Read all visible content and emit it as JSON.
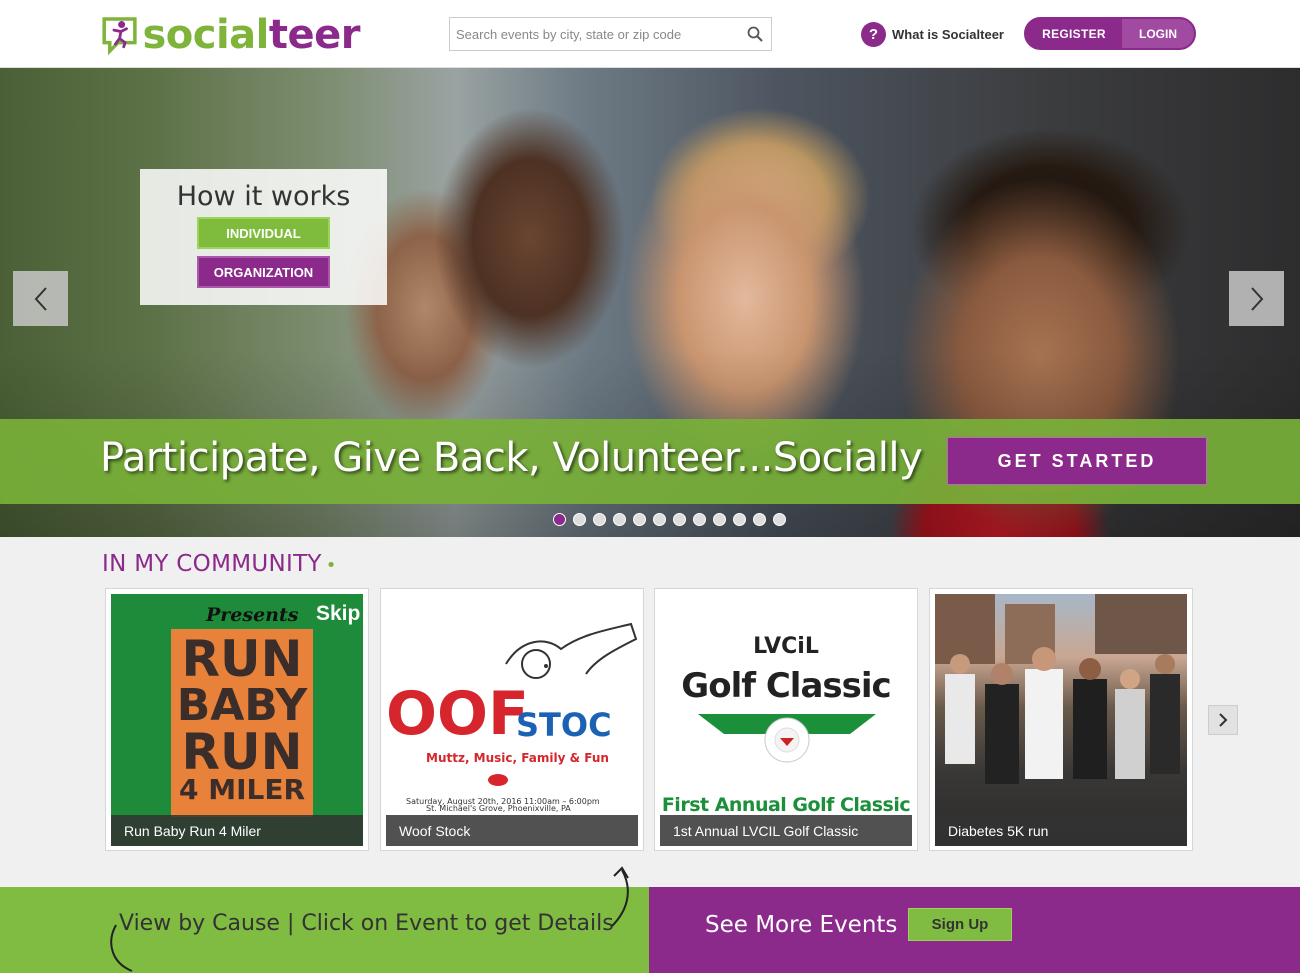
{
  "header": {
    "logo_text_a": "social",
    "logo_text_b": "teer",
    "search_placeholder": "Search events by city, state or zip code",
    "what_is_label": "What is Socialteer",
    "help_glyph": "?",
    "register_label": "REGISTER",
    "login_label": "LOGIN"
  },
  "hero": {
    "how_title": "How it works",
    "individual_label": "INDIVIDUAL",
    "organization_label": "ORGANIZATION",
    "tagline": "Participate, Give Back, Volunteer...Socially",
    "cta_label": "GET STARTED",
    "slide_count": 12,
    "active_slide": 1
  },
  "community": {
    "title": "IN MY COMMUNITY",
    "events": [
      {
        "name": "Run Baby Run 4 Miler",
        "art": {
          "presents": "Presents",
          "skip": "Skip",
          "lines": [
            "RUN",
            "BABY",
            "RUN",
            "4 MILER"
          ]
        }
      },
      {
        "name": "Woof Stock",
        "art": {
          "brand_a": "OOF",
          "brand_b": "STOC",
          "sub": "Muttz, Music, Family & Fun",
          "date": "Saturday, August 20th, 2016 11:00am – 6:00pm",
          "place": "St. Michael's Grove, Phoenixville, PA"
        }
      },
      {
        "name": "1st Annual LVCIL Golf Classic",
        "art": {
          "org": "LVCiL",
          "title": "Golf Classic",
          "sub": "First Annual Golf Classic"
        }
      },
      {
        "name": "Diabetes 5K run"
      }
    ]
  },
  "bottom": {
    "left_text": "View by Cause | Click on Event to get Details",
    "right_text": "See More Events",
    "signup_label": "Sign Up"
  },
  "colors": {
    "purple": "#8b2a8b",
    "green": "#80bb42"
  },
  "icons": [
    "logo-icon",
    "search-icon",
    "question-icon",
    "chevron-left-icon",
    "chevron-right-icon",
    "curl-arrow-icon"
  ]
}
